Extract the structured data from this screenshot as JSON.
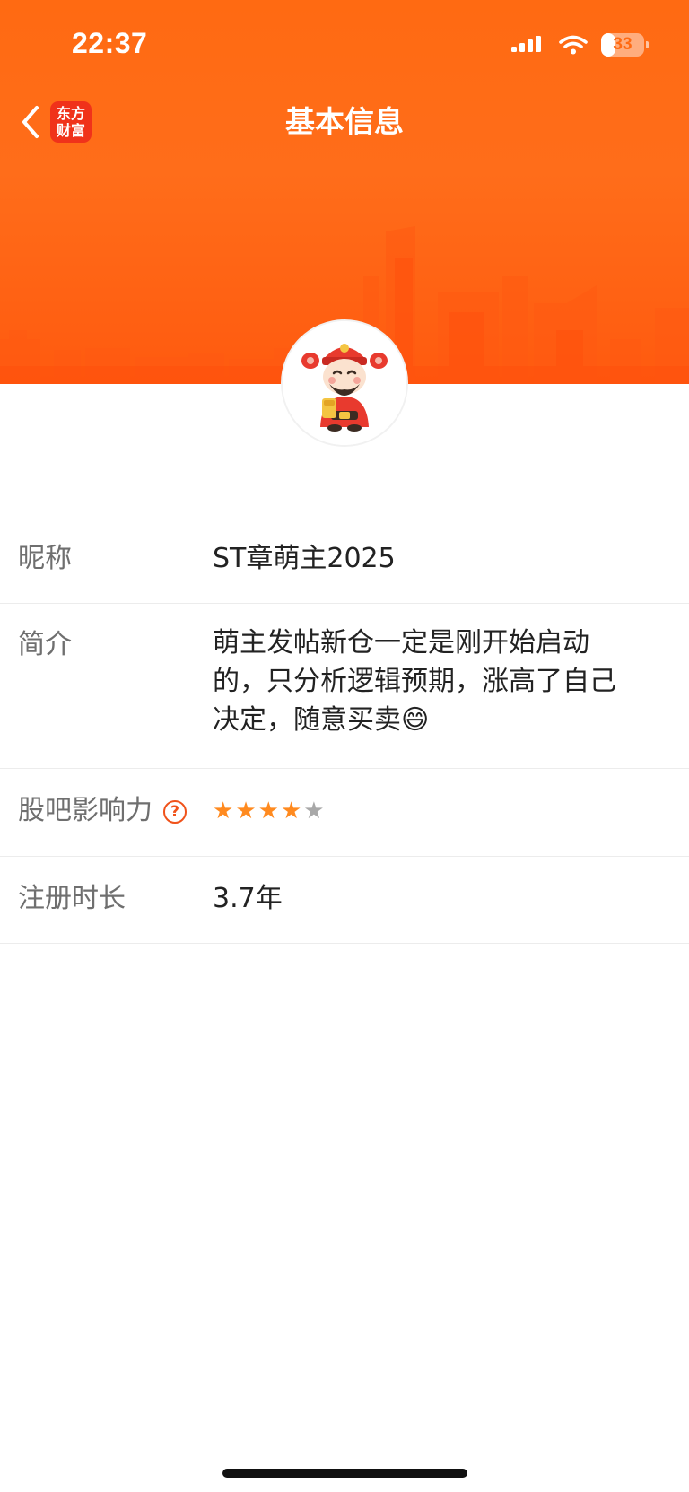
{
  "status_bar": {
    "time": "22:37",
    "battery_level": "33",
    "battery_fraction": 0.33
  },
  "nav": {
    "title": "基本信息",
    "back_icon": "chevron-left-icon",
    "app_logo_line1": "东方",
    "app_logo_line2": "财富"
  },
  "colors": {
    "header_orange": "#ff6a12",
    "accent": "#f0521a",
    "star_filled": "#ff8a1f",
    "star_empty": "#a8a8a8"
  },
  "profile": {
    "nickname_label": "昵称",
    "nickname": "ST章萌主2025",
    "bio_label": "简介",
    "bio": "萌主发帖新仓一定是刚开始启动的，只分析逻辑预期，涨高了自己决定，随意买卖😄",
    "influence_label": "股吧影响力",
    "influence_help_icon": "question-circle-icon",
    "influence_stars": 4,
    "influence_max_stars": 5,
    "registration_label": "注册时长",
    "registration": "3.7年"
  }
}
